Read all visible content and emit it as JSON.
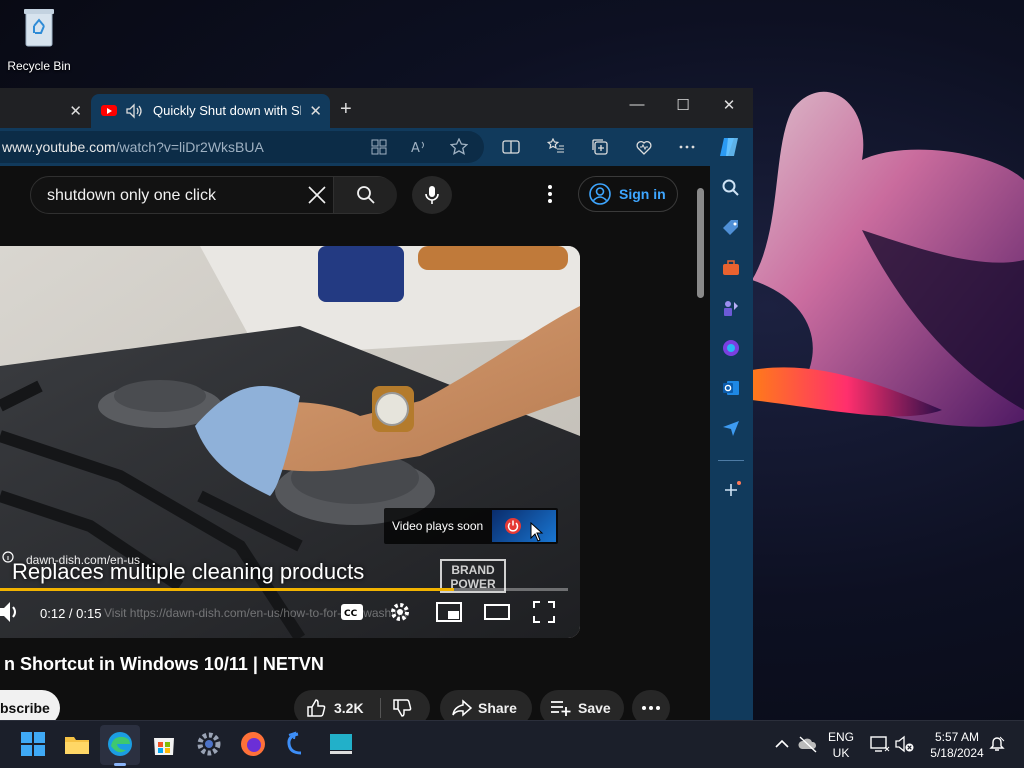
{
  "desktop": {
    "recycle_bin_label": "Recycle Bin"
  },
  "browser": {
    "active_tab_title": "Quickly Shut down with Sho",
    "url_host": "www.youtube.com",
    "url_path": "/watch?v=liDr2WksBUA"
  },
  "youtube": {
    "search_query": "shutdown only one click",
    "sign_in_label": "Sign in",
    "player": {
      "ad_domain": "dawn-dish.com/en-us",
      "caption": "Replaces multiple cleaning products",
      "brand_badge_line1": "BRAND",
      "brand_badge_line2": "POWER",
      "video_plays_soon": "Video plays soon",
      "time": "0:12 / 0:15",
      "ad_link": "Visit https://dawn-dish.com/en-us/how-to-for-dishwashing",
      "progress": 0.8
    },
    "video_title": "n Shortcut in Windows 10/11 | NETVN",
    "subscribe_label": "bscribe",
    "like_count": "3.2K",
    "share_label": "Share",
    "save_label": "Save"
  },
  "taskbar": {
    "language_line1": "ENG",
    "language_line2": "UK",
    "clock_time": "5:57 AM",
    "clock_date": "5/18/2024"
  },
  "colors": {
    "tab_active": "#113a5c",
    "sidebar": "#113a5c",
    "progress": "#f2b300",
    "link_blue": "#3ea6ff"
  }
}
